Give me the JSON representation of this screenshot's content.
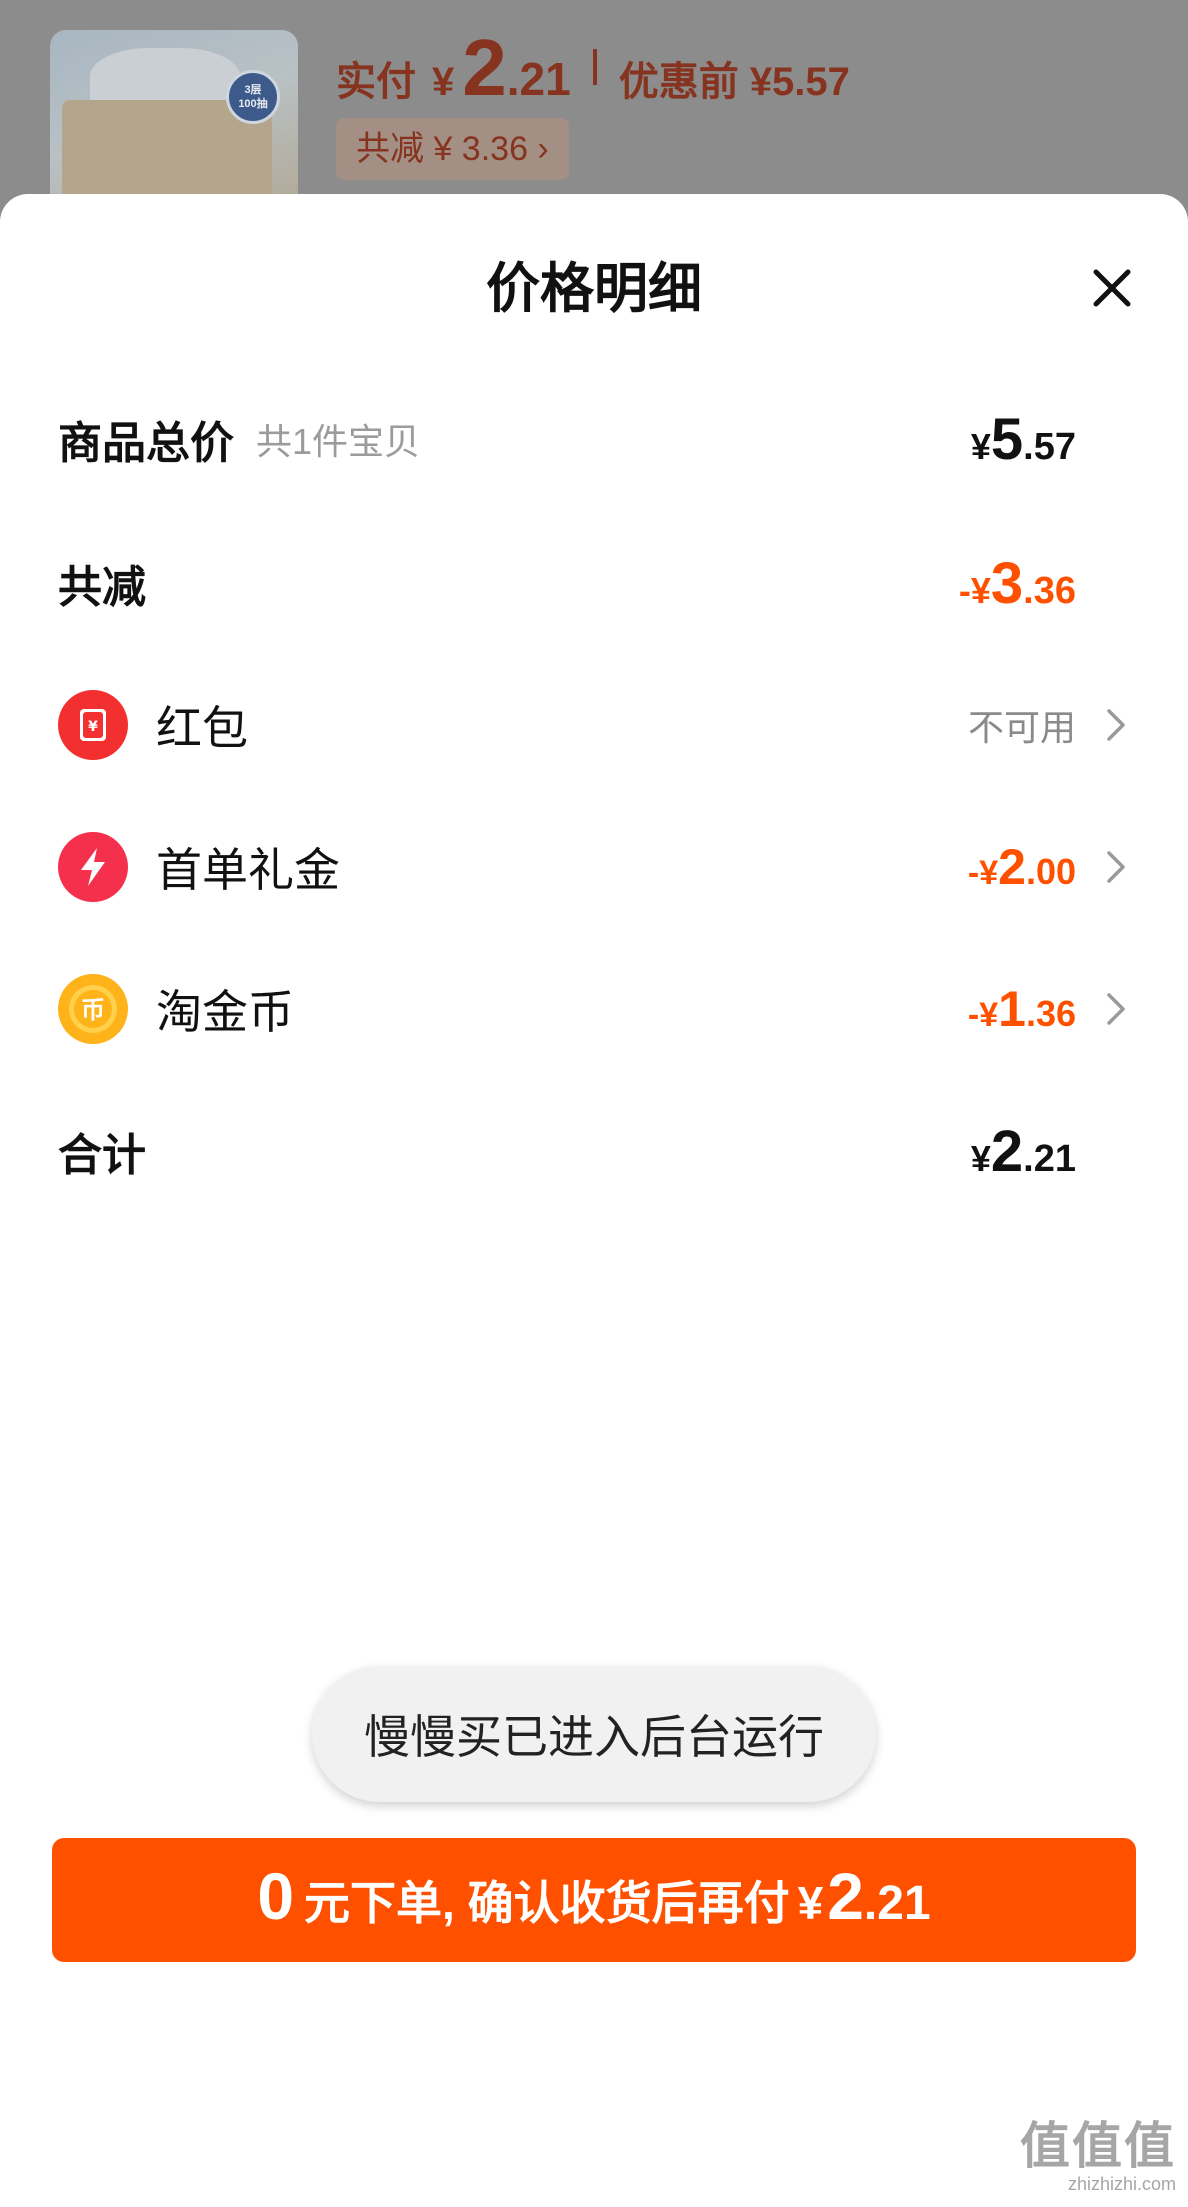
{
  "header": {
    "thumb_badge_line1": "3层",
    "thumb_badge_line2": "100抽",
    "pay_label": "实付",
    "pay_symbol": "¥",
    "pay_int": "2",
    "pay_dec": ".21",
    "before_label": "优惠前 ¥5.57",
    "saving_chip": "共减 ¥ 3.36 ›"
  },
  "sheet": {
    "title": "价格明细",
    "close_icon": "close-icon"
  },
  "rows": {
    "total_goods": {
      "title": "商品总价",
      "sub": "共1件宝贝",
      "symbol": "¥",
      "int": "5",
      "dec": ".57"
    },
    "total_discount": {
      "title": "共减",
      "symbol": "-¥",
      "int": "3",
      "dec": ".36"
    },
    "red_packet": {
      "label": "红包",
      "status": "不可用",
      "icon": "red-packet-icon",
      "icon_color": "#f23030"
    },
    "first_order_gift": {
      "label": "首单礼金",
      "symbol": "-¥",
      "int": "2",
      "dec": ".00",
      "icon": "lightning-icon",
      "icon_color": "#f5304c"
    },
    "tao_coins": {
      "label": "淘金币",
      "symbol": "-¥",
      "int": "1",
      "dec": ".36",
      "icon": "coin-icon",
      "icon_color": "#ffb31a"
    },
    "sum": {
      "title": "合计",
      "symbol": "¥",
      "int": "2",
      "dec": ".21"
    }
  },
  "toast": {
    "text": "慢慢买已进入后台运行"
  },
  "confirm": {
    "zero": "0",
    "text": "元下单, 确认收货后再付",
    "symbol": "¥",
    "int": "2",
    "dec": ".21"
  },
  "watermark": {
    "main": "值值值",
    "sub": "zhizhizhi.com"
  },
  "colors": {
    "accent": "#ff5000",
    "text_primary": "#111111",
    "text_secondary": "#9b9b9b"
  }
}
